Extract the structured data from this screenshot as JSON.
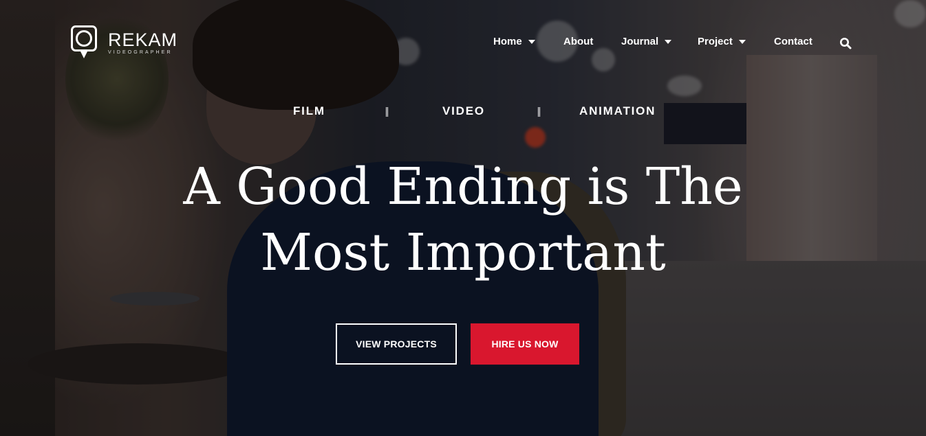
{
  "brand": {
    "name": "REKAM",
    "tagline": "VIDEOGRAPHER"
  },
  "nav": {
    "items": [
      {
        "label": "Home",
        "has_dropdown": true
      },
      {
        "label": "About",
        "has_dropdown": false
      },
      {
        "label": "Journal",
        "has_dropdown": true
      },
      {
        "label": "Project",
        "has_dropdown": true
      },
      {
        "label": "Contact",
        "has_dropdown": false
      }
    ],
    "search_icon": "search-icon"
  },
  "hero": {
    "categories": [
      "FILM",
      "VIDEO",
      "ANIMATION"
    ],
    "title_line1": "A Good Ending is The",
    "title_line2": "Most Important",
    "buttons": {
      "view_projects": "VIEW PROJECTS",
      "hire_us": "HIRE US NOW"
    }
  },
  "colors": {
    "accent": "#d9172e",
    "text": "#ffffff"
  }
}
